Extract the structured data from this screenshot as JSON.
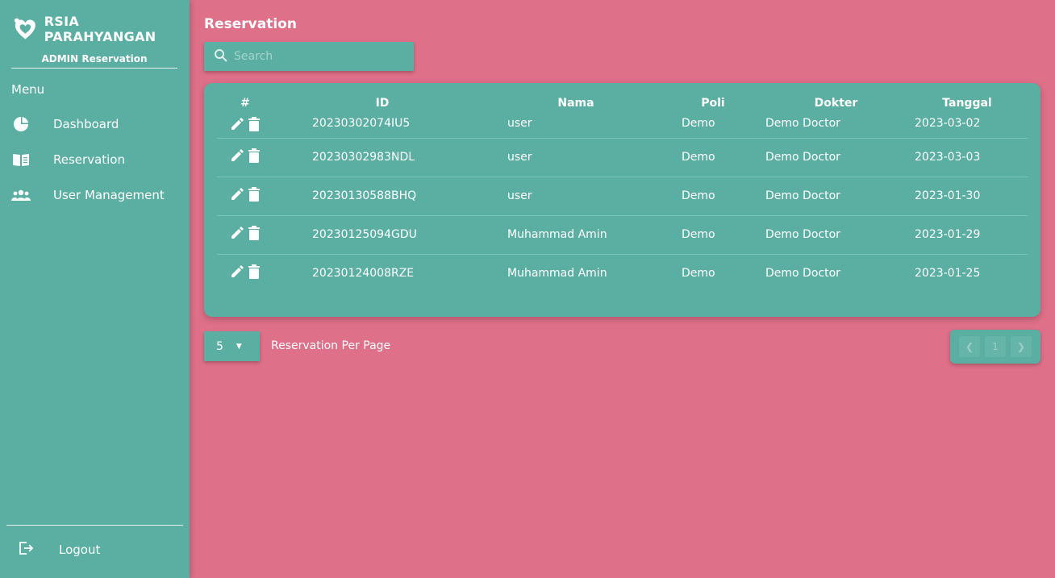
{
  "brand": {
    "name": "RSIA PARAHYANGAN",
    "subtitle": "ADMIN Reservation"
  },
  "sidebar": {
    "menu_title": "Menu",
    "items": [
      {
        "label": "Dashboard",
        "icon": "pie-chart-icon"
      },
      {
        "label": "Reservation",
        "icon": "book-icon"
      },
      {
        "label": "User Management",
        "icon": "users-icon"
      }
    ],
    "logout_label": "Logout"
  },
  "page": {
    "title": "Reservation"
  },
  "search": {
    "placeholder": "Search"
  },
  "table": {
    "headers": [
      "#",
      "ID",
      "Nama",
      "Poli",
      "Dokter",
      "Tanggal"
    ],
    "rows": [
      {
        "id": "20230302074IU5",
        "nama": "user",
        "poli": "Demo",
        "dokter": "Demo Doctor",
        "tanggal": "2023-03-02"
      },
      {
        "id": "20230302983NDL",
        "nama": "user",
        "poli": "Demo",
        "dokter": "Demo Doctor",
        "tanggal": "2023-03-03"
      },
      {
        "id": "20230130588BHQ",
        "nama": "user",
        "poli": "Demo",
        "dokter": "Demo Doctor",
        "tanggal": "2023-01-30"
      },
      {
        "id": "20230125094GDU",
        "nama": "Muhammad Amin",
        "poli": "Demo",
        "dokter": "Demo Doctor",
        "tanggal": "2023-01-29"
      },
      {
        "id": "20230124008RZE",
        "nama": "Muhammad Amin",
        "poli": "Demo",
        "dokter": "Demo Doctor",
        "tanggal": "2023-01-25"
      }
    ]
  },
  "pagination": {
    "per_page_value": "5",
    "per_page_label": "Reservation Per Page",
    "current_page": "1"
  },
  "colors": {
    "background": "#de7089",
    "panel": "#5aafa2",
    "text": "#ffffff"
  }
}
